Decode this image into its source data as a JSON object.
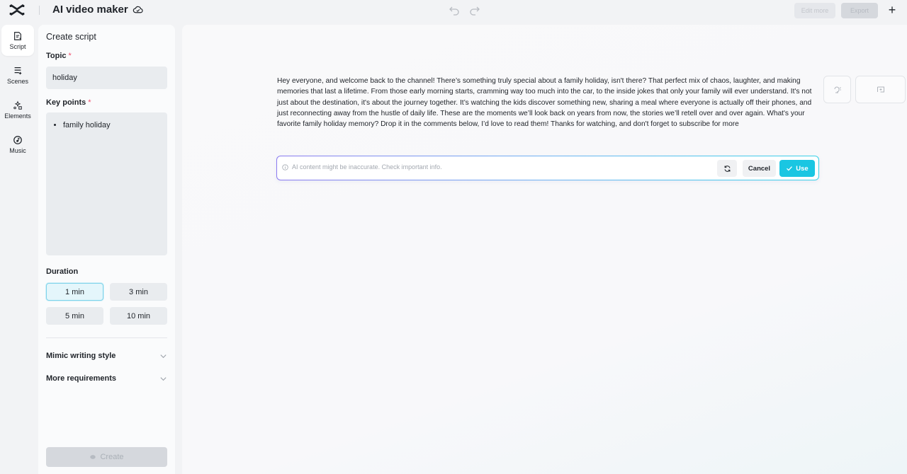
{
  "app": {
    "title": "AI video maker"
  },
  "toolbar": {
    "edit_more": "Edit more",
    "export": "Export",
    "add": "+"
  },
  "rail": {
    "items": [
      {
        "label": "Script",
        "icon": "script-icon",
        "active": true
      },
      {
        "label": "Scenes",
        "icon": "scenes-icon",
        "active": false
      },
      {
        "label": "Elements",
        "icon": "elements-icon",
        "active": false
      },
      {
        "label": "Music",
        "icon": "music-icon",
        "active": false
      }
    ]
  },
  "panel": {
    "title": "Create script",
    "topic": {
      "label": "Topic",
      "required": "*",
      "value": "holiday"
    },
    "key_points": {
      "label": "Key points",
      "required": "*",
      "items": [
        "family holiday"
      ]
    },
    "duration": {
      "label": "Duration",
      "options": [
        "1 min",
        "3 min",
        "5 min",
        "10 min"
      ],
      "selected": "1 min"
    },
    "mimic": "Mimic writing style",
    "more": "More requirements",
    "create": "Create"
  },
  "main": {
    "script": "Hey everyone, and welcome back to the channel! There’s something truly special about a family holiday, isn't there? That perfect mix of chaos, laughter, and making memories that last a lifetime. From those early morning starts, cramming way too much into the car, to the inside jokes that only your family will ever understand. It's not just about the destination, it's about the journey together. It’s watching the kids discover something new, sharing a meal where everyone is actually off their phones, and just reconnecting away from the hustle of daily life. These are the moments we’ll look back on years from now, the stories we’ll retell over and over again. What's your favorite family holiday memory? Drop it in the comments below, I’d love to read them! Thanks for watching, and don't forget to subscribe for more",
    "ai_note": "AI content might be inaccurate. Check important info.",
    "cancel": "Cancel",
    "use": "Use"
  },
  "colors": {
    "accent": "#1ac6e2",
    "required": "#f0506e"
  }
}
